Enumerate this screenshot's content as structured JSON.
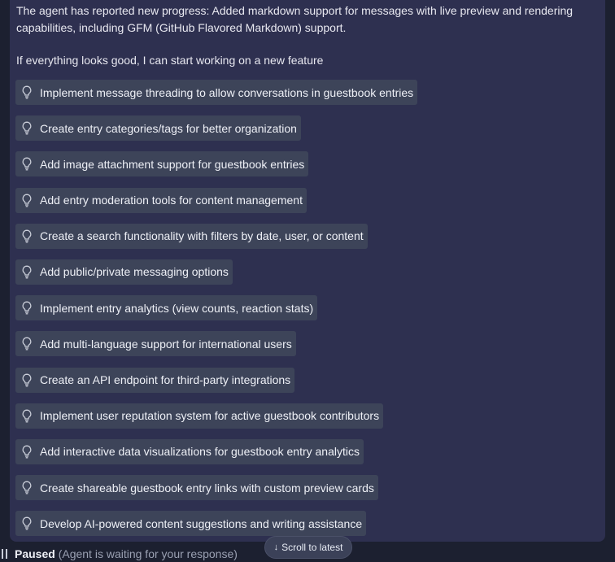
{
  "message": {
    "intro": "The agent has reported new progress: Added markdown support for messages with live preview and rendering capabilities, including GFM (GitHub Flavored Markdown) support.",
    "lead": "If everything looks good, I can start working on a new feature"
  },
  "suggestions": [
    {
      "label": "Implement message threading to allow conversations in guestbook entries",
      "icon": "lightbulb-icon"
    },
    {
      "label": "Create entry categories/tags for better organization",
      "icon": "lightbulb-icon"
    },
    {
      "label": "Add image attachment support for guestbook entries",
      "icon": "lightbulb-icon"
    },
    {
      "label": "Add entry moderation tools for content management",
      "icon": "lightbulb-icon"
    },
    {
      "label": "Create a search functionality with filters by date, user, or content",
      "icon": "lightbulb-icon"
    },
    {
      "label": "Add public/private messaging options",
      "icon": "lightbulb-icon"
    },
    {
      "label": "Implement entry analytics (view counts, reaction stats)",
      "icon": "lightbulb-icon"
    },
    {
      "label": "Add multi-language support for international users",
      "icon": "lightbulb-icon"
    },
    {
      "label": "Create an API endpoint for third-party integrations",
      "icon": "lightbulb-icon"
    },
    {
      "label": "Implement user reputation system for active guestbook contributors",
      "icon": "lightbulb-icon"
    },
    {
      "label": "Add interactive data visualizations for guestbook entry analytics",
      "icon": "lightbulb-icon"
    },
    {
      "label": "Create shareable guestbook entry links with custom preview cards",
      "icon": "lightbulb-icon"
    },
    {
      "label": "Develop AI-powered content suggestions and writing assistance",
      "icon": "lightbulb-icon"
    }
  ],
  "status": {
    "state": "Paused",
    "detail": "(Agent is waiting for your response)",
    "icon": "pause-icon"
  },
  "scroll_button": {
    "label": "Scroll to latest",
    "icon": "arrow-down-icon"
  },
  "colors": {
    "page_bg": "#1c2030",
    "panel_bg": "#2e3050",
    "chip_bg": "#3d4459"
  }
}
